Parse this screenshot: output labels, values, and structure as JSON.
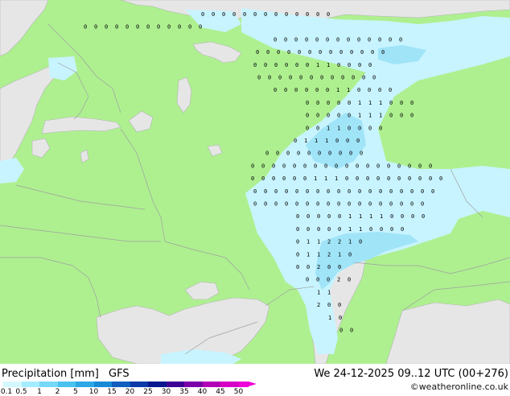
{
  "legend": {
    "title": "Precipitation [mm]",
    "model": "GFS",
    "levels": [
      "0.1",
      "0.5",
      "1",
      "2",
      "5",
      "10",
      "15",
      "20",
      "25",
      "30",
      "35",
      "40",
      "45",
      "50"
    ],
    "colors": [
      "#d3f8ff",
      "#a4ecff",
      "#76d8f8",
      "#49c2f0",
      "#2ea7e6",
      "#178ad6",
      "#0f5dbf",
      "#0c3aa8",
      "#06178f",
      "#3c0096",
      "#7a00a8",
      "#b200b8",
      "#d600c6",
      "#ee00d8"
    ]
  },
  "valid_time": "We 24-12-2025 09..12 UTC (00+276)",
  "credit": "weatheronline.co.uk",
  "colors": {
    "land": "#aef090",
    "sea": "#e6e6e6",
    "light_precip": "#c8f4ff",
    "medium_precip": "#a0e4f8",
    "border": "#a0a0a0"
  },
  "gridpoints": [
    {
      "row": 1,
      "values": [
        "0",
        "0",
        "0",
        "0",
        "0",
        "0",
        "0",
        "0",
        "0",
        "0",
        "0",
        "0",
        "0"
      ]
    },
    {
      "row": 2,
      "values": [
        "0",
        "0",
        "0",
        "0",
        "0",
        "0",
        "0",
        "0",
        "0",
        "0",
        "0",
        "0"
      ]
    },
    {
      "row": 3,
      "values": [
        "0",
        "0",
        "0",
        "0",
        "0",
        "0",
        "0",
        "0",
        "0",
        "0",
        "0",
        "0",
        "0"
      ]
    },
    {
      "row": 4,
      "values": [
        "0",
        "0",
        "0",
        "0",
        "0",
        "0",
        "0",
        "0",
        "0",
        "0",
        "0",
        "0",
        "0"
      ]
    },
    {
      "row": 5,
      "values": [
        "0",
        "0",
        "0",
        "0",
        "0",
        "0",
        "1",
        "1",
        "0",
        "0",
        "0",
        "0"
      ]
    },
    {
      "row": 6,
      "values": [
        "0",
        "0",
        "0",
        "0",
        "0",
        "0",
        "0",
        "0",
        "0",
        "0",
        "0",
        "0"
      ]
    },
    {
      "row": 7,
      "values": [
        "0",
        "0",
        "0",
        "0",
        "0",
        "0",
        "1",
        "1",
        "0",
        "0",
        "0",
        "0"
      ]
    },
    {
      "row": 8,
      "values": [
        "0",
        "0",
        "0",
        "0",
        "0",
        "1",
        "1",
        "1",
        "0",
        "0",
        "0"
      ]
    },
    {
      "row": 9,
      "values": [
        "0",
        "0",
        "0",
        "0",
        "0",
        "1",
        "1",
        "1",
        "0",
        "0",
        "0"
      ]
    },
    {
      "row": 10,
      "values": [
        "0",
        "0",
        "1",
        "1",
        "0",
        "0",
        "0",
        "0"
      ]
    },
    {
      "row": 11,
      "values": [
        "0",
        "1",
        "1",
        "1",
        "0",
        "0",
        "0"
      ]
    },
    {
      "row": 12,
      "values": [
        "0",
        "0",
        "0",
        "0",
        "0",
        "0",
        "0",
        "0",
        "0",
        "0"
      ]
    },
    {
      "row": 13,
      "values": [
        "0",
        "0",
        "0",
        "0",
        "0",
        "0",
        "0",
        "0",
        "0",
        "0",
        "0",
        "0",
        "0",
        "0",
        "0",
        "0",
        "0",
        "0"
      ]
    },
    {
      "row": 14,
      "values": [
        "0",
        "0",
        "0",
        "0",
        "0",
        "0",
        "1",
        "1",
        "1",
        "0",
        "0",
        "0",
        "0",
        "0",
        "0",
        "0",
        "0",
        "0",
        "0"
      ]
    },
    {
      "row": 15,
      "values": [
        "0",
        "0",
        "0",
        "0",
        "0",
        "0",
        "0",
        "0",
        "0",
        "0",
        "0",
        "0",
        "0",
        "0",
        "0",
        "0",
        "0",
        "0"
      ]
    },
    {
      "row": 16,
      "values": [
        "0",
        "0",
        "0",
        "0",
        "0",
        "0",
        "0",
        "0",
        "0",
        "0",
        "0",
        "0",
        "0",
        "0",
        "0",
        "0",
        "0"
      ]
    },
    {
      "row": 17,
      "values": [
        "0",
        "0",
        "0",
        "0",
        "0",
        "1",
        "1",
        "1",
        "1",
        "0",
        "0",
        "0",
        "0"
      ]
    },
    {
      "row": 18,
      "values": [
        "0",
        "0",
        "0",
        "0",
        "0",
        "1",
        "1",
        "0",
        "0",
        "0",
        "0"
      ]
    },
    {
      "row": 19,
      "values": [
        "0",
        "1",
        "1",
        "2",
        "2",
        "1",
        "0"
      ]
    },
    {
      "row": 20,
      "values": [
        "0",
        "1",
        "1",
        "2",
        "1",
        "0"
      ]
    },
    {
      "row": 21,
      "values": [
        "0",
        "0",
        "2",
        "0",
        "0"
      ]
    },
    {
      "row": 22,
      "values": [
        "0",
        "0",
        "0",
        "2",
        "0"
      ]
    },
    {
      "row": 23,
      "values": [
        "1",
        "1"
      ]
    },
    {
      "row": 24,
      "values": [
        "2",
        "0",
        "0"
      ]
    },
    {
      "row": 25,
      "values": [
        "1",
        "0"
      ]
    },
    {
      "row": 26,
      "values": [
        "0",
        "0"
      ]
    }
  ]
}
